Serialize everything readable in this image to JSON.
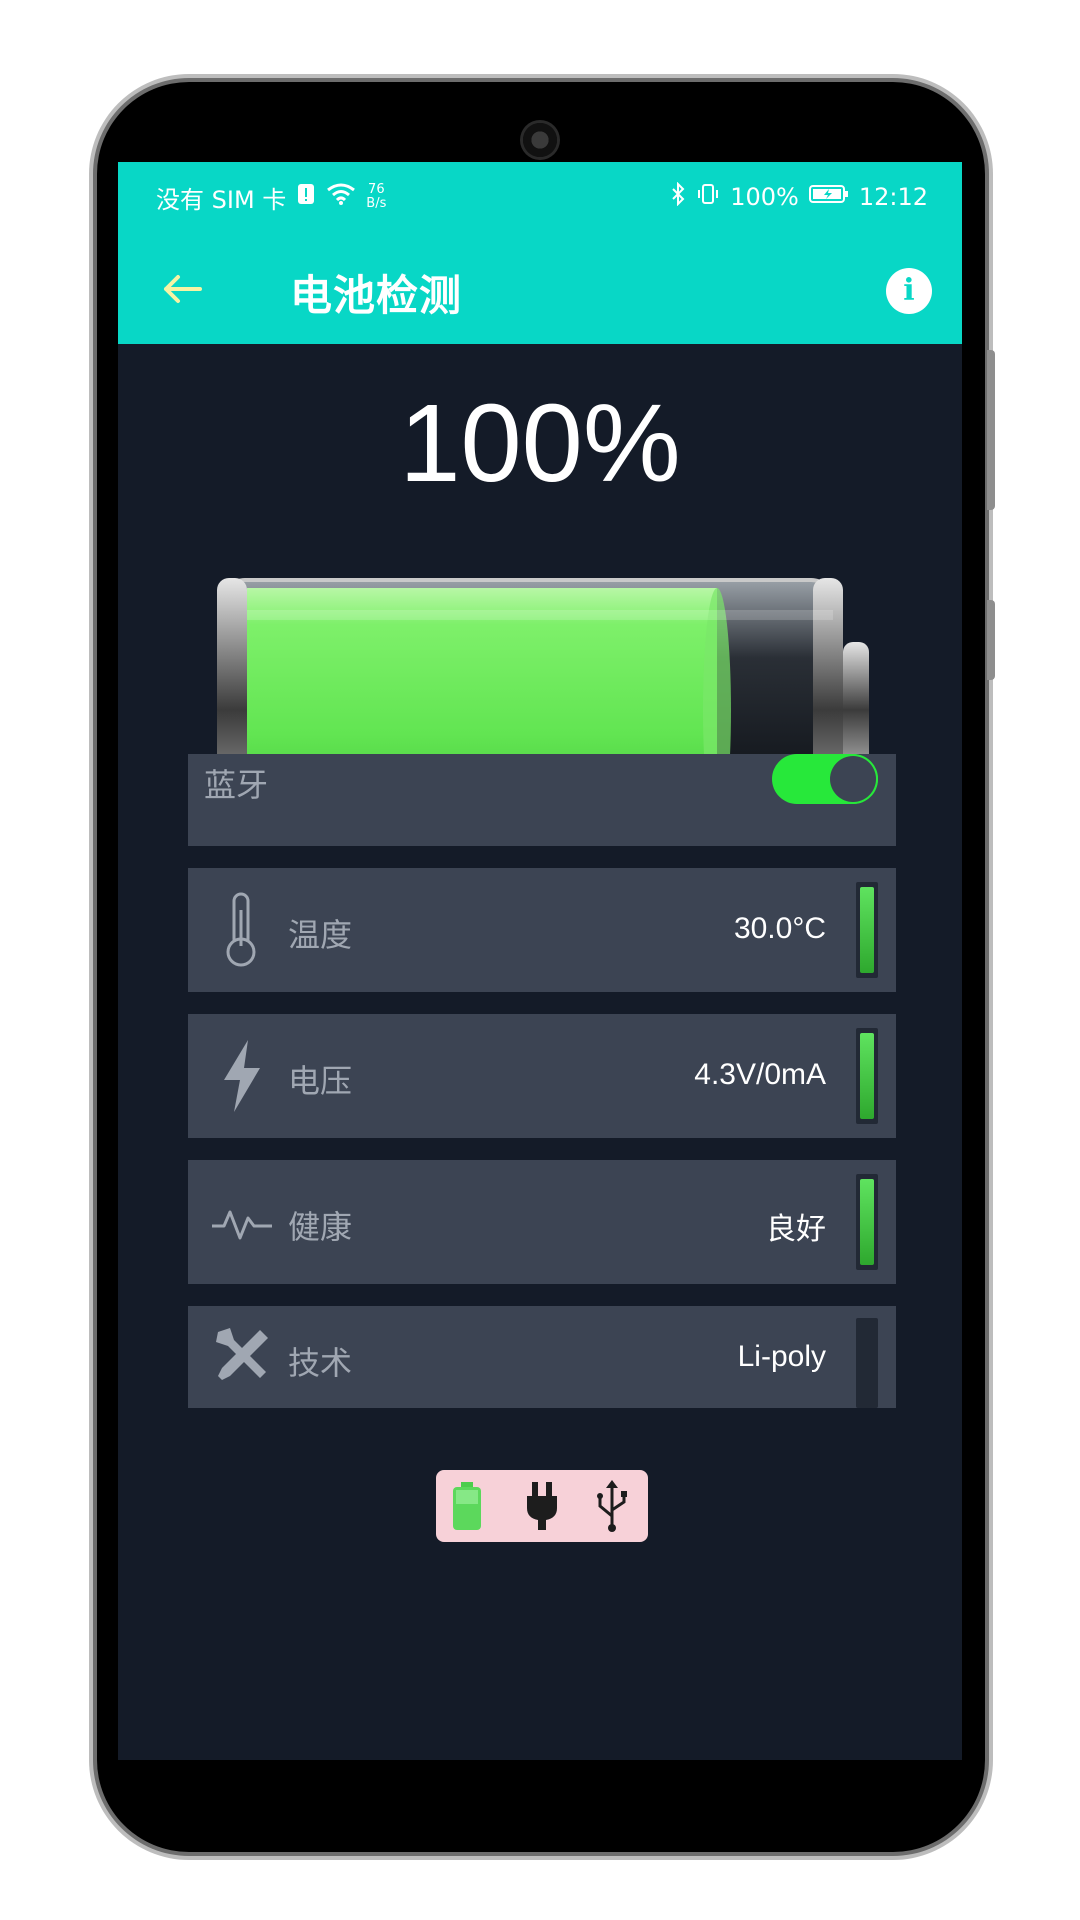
{
  "status_bar": {
    "carrier": "没有 SIM 卡",
    "net_speed_value": "76",
    "net_speed_unit": "B/s",
    "battery_percent": "100%",
    "time": "12:12"
  },
  "app_bar": {
    "back_icon": "arrow-left-icon",
    "title": "电池检测",
    "info_icon": "info-icon"
  },
  "battery": {
    "percent_text": "100%",
    "level": 1.0
  },
  "bluetooth": {
    "label": "蓝牙",
    "enabled": true
  },
  "rows": [
    {
      "icon": "thermometer-icon",
      "label": "温度",
      "value": "30.0°C",
      "level": 0.9
    },
    {
      "icon": "lightning-icon",
      "label": "电压",
      "value": "4.3V/0mA",
      "level": 0.9
    },
    {
      "icon": "pulse-icon",
      "label": "健康",
      "value": "良好",
      "level": 0.9
    },
    {
      "icon": "tools-icon",
      "label": "技术",
      "value": "Li-poly",
      "level": 0.0
    }
  ],
  "power_sources": {
    "icons": [
      "battery-icon",
      "plug-icon",
      "usb-icon"
    ],
    "active": "battery-icon"
  },
  "colors": {
    "accent": "#08d7c6",
    "background": "#141b28",
    "row_bg": "#3c4453",
    "green": "#27e83a"
  }
}
